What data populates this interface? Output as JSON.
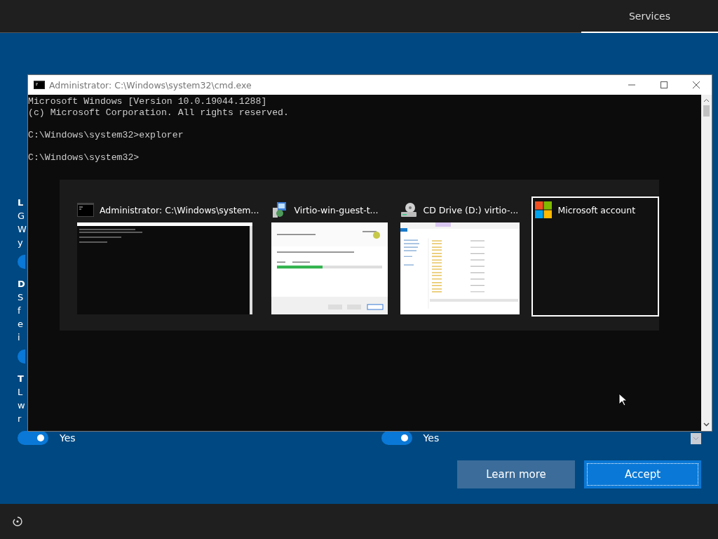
{
  "top_bar": {
    "tabs": [
      {
        "label": "Services",
        "selected": true
      }
    ]
  },
  "background_page": {
    "sections": [
      {
        "heading": "L",
        "lines": [
          "G",
          "W",
          "y"
        ],
        "toggle": {
          "on": true
        }
      },
      {
        "heading": "D",
        "lines": [
          "S",
          "f",
          "e",
          "i"
        ],
        "toggle": {
          "on": true
        }
      },
      {
        "heading": "T",
        "lines": [
          "L",
          "w",
          "r"
        ],
        "toggle": {
          "on": true,
          "label": "Yes"
        }
      }
    ],
    "second_toggle": {
      "on": true,
      "label": "Yes"
    }
  },
  "console_window": {
    "title": "Administrator: C:\\Windows\\system32\\cmd.exe",
    "blocks": [
      [
        "Microsoft Windows [Version 10.0.19044.1288]",
        "(c) Microsoft Corporation. All rights reserved."
      ],
      [
        "C:\\Windows\\system32>explorer"
      ],
      [
        "C:\\Windows\\system32>"
      ]
    ]
  },
  "task_switcher": {
    "items": [
      {
        "title": "Administrator: C:\\Windows\\system...",
        "kind": "console",
        "selected": false
      },
      {
        "title": "Virtio-win-guest-t...",
        "kind": "installer",
        "selected": false
      },
      {
        "title": "CD Drive (D:) virtio-...",
        "kind": "explorer",
        "selected": false
      },
      {
        "title": "Microsoft account",
        "kind": "account",
        "selected": true
      }
    ]
  },
  "buttons": [
    {
      "label": "Learn more",
      "kind": "secondary"
    },
    {
      "label": "Accept",
      "kind": "primary"
    }
  ]
}
